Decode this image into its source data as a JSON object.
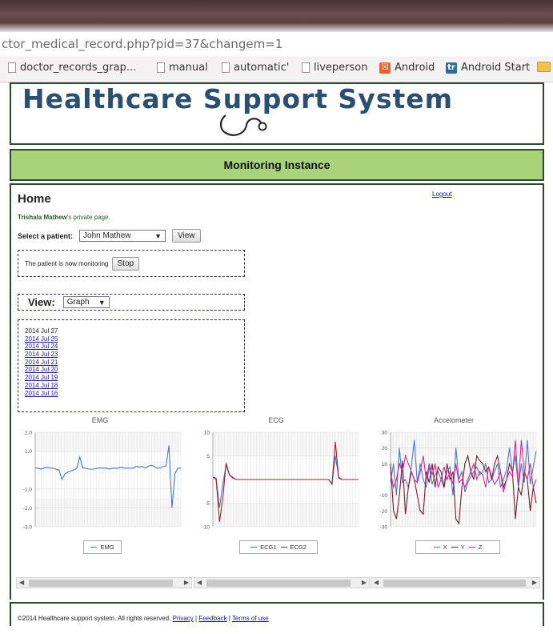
{
  "browser": {
    "url": "ctor_medical_record.php?pid=37&changem=1",
    "bookmarks": [
      {
        "label": "doctor_records_grap...",
        "icon": "page-icon"
      },
      {
        "label": "manual",
        "icon": "page-icon"
      },
      {
        "label": "automatic'",
        "icon": "page-icon"
      },
      {
        "label": "liveperson",
        "icon": "page-icon"
      },
      {
        "label": "Android",
        "icon": "android-icon"
      },
      {
        "label": "Android Start",
        "icon": "tr-icon"
      }
    ]
  },
  "header": {
    "logo": "Healthcare Support System"
  },
  "nav": {
    "title": "Monitoring Instance"
  },
  "main": {
    "home": "Home",
    "logout": "Logout",
    "user_name": "Trishala Mathew",
    "private_suffix": "'s private page.",
    "select_label": "Select a patient:",
    "patient": "John Mathew",
    "view_button": "View",
    "monitoring_text": "The patient is now monitoring",
    "stop_button": "Stop",
    "view_label": "View:",
    "view_mode": "Graph",
    "dates": [
      "2014 Jul 27",
      "2014 Jul 25",
      "2014 Jul 24",
      "2014 Jul 23",
      "2014 Jul 21",
      "2014 Jul 20",
      "2014 Jul 19",
      "2014 Jul 18",
      "2014 Jul 16"
    ]
  },
  "footer": {
    "copyright": "©2014 Healthcare support system. All rights reserved.",
    "privacy": "Privacy",
    "feedback": "Feedback",
    "terms": "Terms of use"
  },
  "colors": {
    "nav_green": "#a9d37b",
    "logo_blue": "#2a4f72",
    "border_green": "#2e4a2e"
  },
  "chart_data": [
    {
      "type": "line",
      "title": "EMG",
      "yticks": [
        "2.0",
        "1.0",
        "-1.0",
        "-2.0",
        "-3.0"
      ],
      "ylim": [
        -3,
        2
      ],
      "grid": true,
      "series": [
        {
          "name": "EMG",
          "color": "#4a78c6",
          "values": [
            0.1,
            0.1,
            0.05,
            0.1,
            0.15,
            0.1,
            0.1,
            0.05,
            0.0,
            -0.5,
            -0.2,
            -0.1,
            -0.05,
            0.0,
            0.1,
            0.7,
            0.1,
            0.1,
            0.05,
            0.05,
            0.05,
            0.1,
            0.1,
            0.1,
            0.1,
            0.05,
            0.1,
            0.1,
            0.1,
            0.15,
            0.1,
            0.1,
            0.1,
            0.1,
            0.2,
            0.15,
            0.2,
            0.1,
            0.2,
            0.25,
            0.2,
            0.1,
            0.1,
            0.2,
            0.2,
            1.3,
            -2.0,
            -0.2,
            0.1,
            0.1
          ]
        }
      ]
    },
    {
      "type": "line",
      "title": "ECG",
      "yticks": [
        "10",
        "5",
        "-5",
        "-10"
      ],
      "ylim": [
        -10,
        10
      ],
      "grid": true,
      "series": [
        {
          "name": "ECG1",
          "color": "#4a78c6",
          "values": [
            0.5,
            0.3,
            -6,
            -1,
            3,
            1,
            0.5,
            0,
            0,
            0,
            0,
            0,
            0,
            0,
            0,
            0,
            0,
            0,
            0,
            0,
            0,
            0,
            0,
            0,
            0,
            0,
            0,
            0,
            0,
            0,
            0,
            0,
            0,
            0,
            0,
            0,
            -1,
            5,
            0.5,
            0,
            0,
            0,
            0,
            0,
            0
          ]
        },
        {
          "name": "ECG2",
          "color": "#a31f2e",
          "values": [
            0.5,
            0,
            -9,
            -4,
            3.5,
            1,
            0.3,
            0,
            0,
            0,
            0,
            0,
            0,
            0,
            0,
            0,
            0,
            0,
            0,
            0,
            0,
            0,
            0,
            0,
            0,
            0,
            0,
            0,
            0,
            0,
            0,
            0,
            0,
            0,
            0,
            0,
            -1,
            8,
            0.3,
            0,
            0,
            0,
            0,
            0,
            0
          ]
        }
      ]
    },
    {
      "type": "line",
      "title": "Accelometer",
      "yticks": [
        "30",
        "20",
        "10",
        "-10",
        "-20",
        "-30"
      ],
      "ylim": [
        -30,
        30
      ],
      "grid": true,
      "series": [
        {
          "name": "X",
          "color": "#4a78c6",
          "values": [
            -2,
            10,
            -10,
            20,
            -2,
            0,
            -5,
            8,
            25,
            -2,
            10,
            0,
            -5,
            8,
            -3,
            3,
            5,
            0,
            -5,
            5,
            8,
            -10,
            20,
            0,
            5,
            -8,
            -2,
            2,
            5,
            8,
            3,
            5,
            10,
            -2,
            0,
            5,
            10,
            -5,
            0,
            6,
            20,
            5,
            15,
            -5,
            10,
            -2,
            25,
            -3,
            8,
            18
          ]
        },
        {
          "name": "Y",
          "color": "#7a1a2a",
          "values": [
            10,
            -20,
            -25,
            -10,
            12,
            -22,
            -5,
            5,
            0,
            -10,
            -20,
            -22,
            5,
            -2,
            10,
            -5,
            8,
            5,
            -5,
            10,
            0,
            5,
            -25,
            -28,
            -5,
            10,
            15,
            5,
            0,
            15,
            12,
            10,
            5,
            8,
            0,
            10,
            15,
            5,
            -5,
            0,
            10,
            5,
            -25,
            -5,
            -10,
            5,
            0,
            -20,
            -5,
            -15
          ]
        },
        {
          "name": "Z",
          "color": "#d6249d",
          "values": [
            5,
            -5,
            0,
            10,
            5,
            15,
            10,
            5,
            0,
            -2,
            5,
            15,
            0,
            10,
            3,
            10,
            -5,
            0,
            8,
            0,
            5,
            -3,
            10,
            -2,
            0,
            -5,
            0,
            5,
            10,
            0,
            5,
            3,
            -5,
            8,
            2,
            -3,
            0,
            5,
            -8,
            0,
            5,
            2,
            25,
            -5,
            25,
            5,
            0,
            10,
            -5,
            0
          ]
        }
      ]
    }
  ]
}
